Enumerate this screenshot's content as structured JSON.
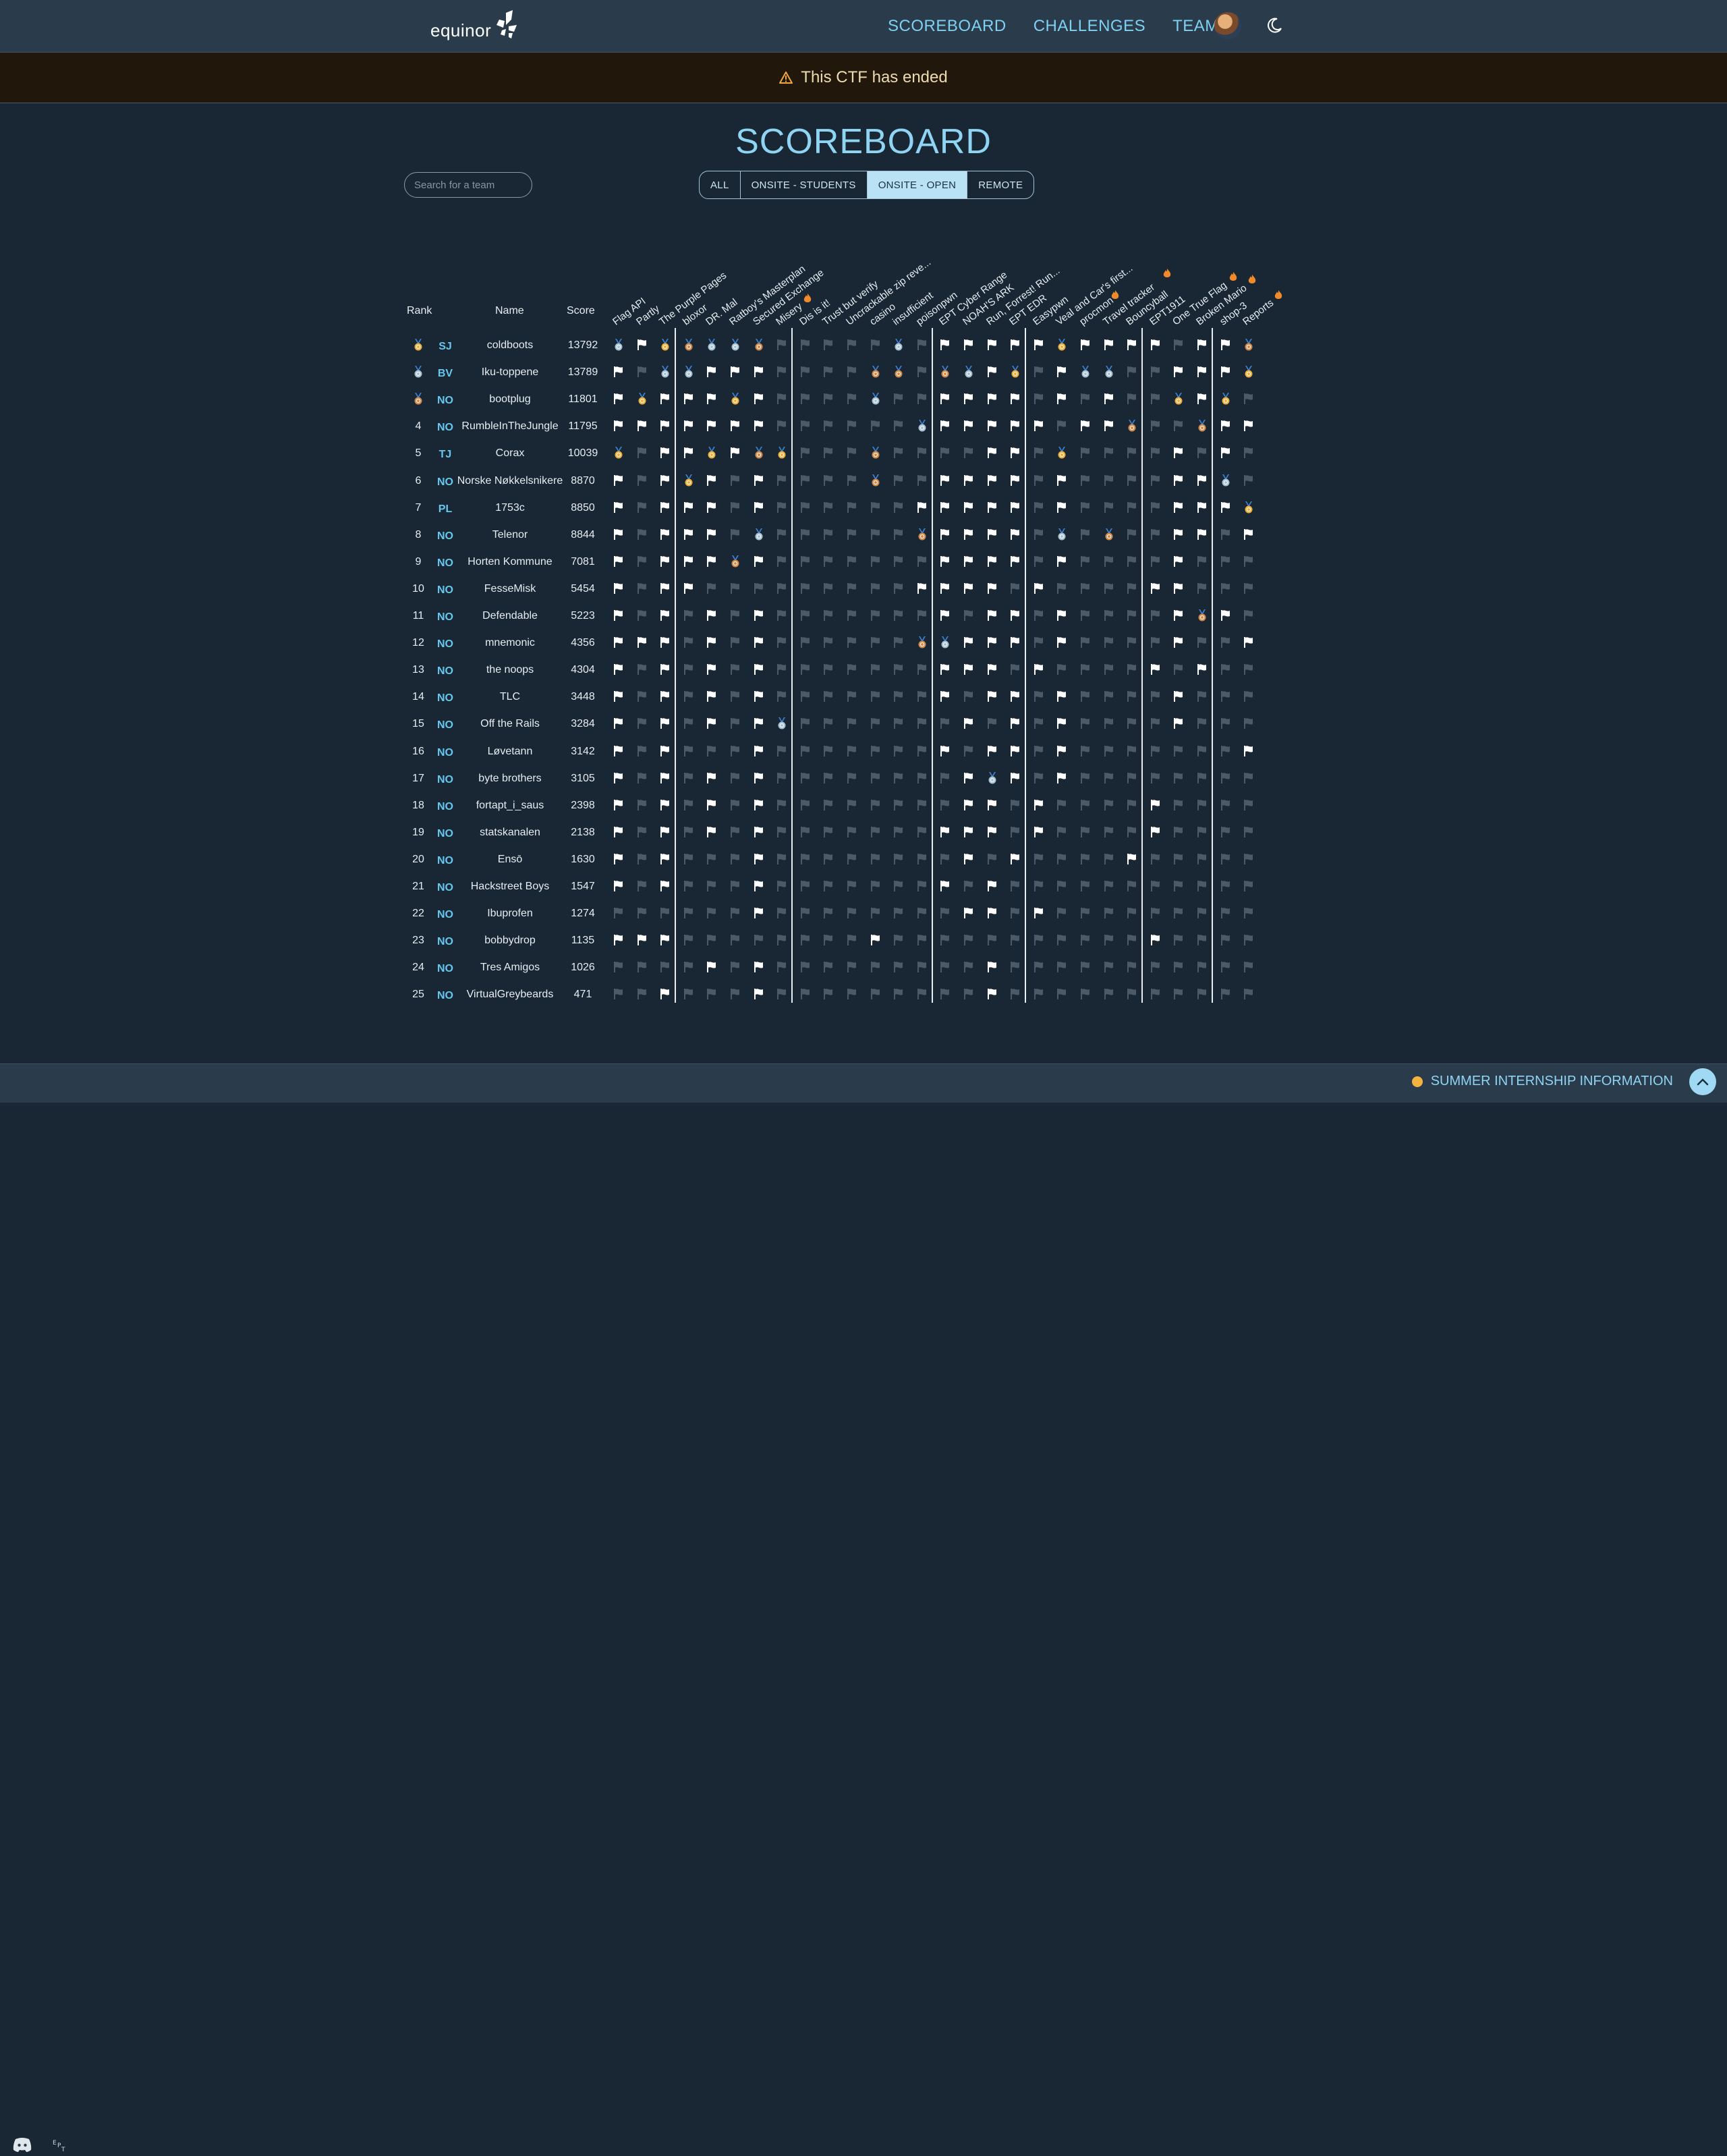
{
  "nav": {
    "logo_text": "equinor",
    "links": [
      "SCOREBOARD",
      "CHALLENGES",
      "TEAM"
    ]
  },
  "banner": {
    "text": "This CTF has ended"
  },
  "title": "SCOREBOARD",
  "search": {
    "placeholder": "Search for a team"
  },
  "filters": [
    {
      "label": "ALL",
      "active": false
    },
    {
      "label": "ONSITE - STUDENTS",
      "active": false
    },
    {
      "label": "ONSITE - OPEN",
      "active": true
    },
    {
      "label": "REMOTE",
      "active": false
    }
  ],
  "columns": {
    "rank": "Rank",
    "name": "Name",
    "score": "Score"
  },
  "challenges": [
    "Flag API",
    "Partly",
    "The Purple Pages",
    "bloxor",
    "DR. Mal",
    "Ratboy's Masterplan",
    "Secured Exchange",
    "Misery",
    "Dis is it!",
    "Trust but verify",
    "Uncrackable zip reve...",
    "casino",
    "insufficient",
    "poisonpwn",
    "EPT Cyber Range",
    "NOAH'S ARK",
    "Run, Forrest! Run...",
    "EPT EDR",
    "Easypwn",
    "Veal and Car's first...",
    "procmon",
    "Travel tracker",
    "Bouncyball",
    "EPT1911",
    "One True Flag",
    "Broken Mario",
    "shop-3",
    "Reports"
  ],
  "fire_challenges": [
    "Misery",
    "procmon",
    "Travel tracker",
    "One True Flag",
    "Broken Mario",
    "Reports"
  ],
  "legend": "S=solved, .=unsolved, G=gold medal, V=silver medal, B=bronze medal",
  "teams": [
    {
      "rank": "1",
      "medal": "G",
      "country": "SJ",
      "name": "coldboots",
      "score": "13792",
      "solves": "VSGBVVB.....V.SSSSSGSSSS.SSBSB"
    },
    {
      "rank": "2",
      "medal": "V",
      "country": "BV",
      "name": "Iku-toppene",
      "score": "13789",
      "solves": "S.VVSSS....BB.BVSG.SVV..SSSGS"
    },
    {
      "rank": "3",
      "medal": "B",
      "country": "NO",
      "name": "bootplug",
      "score": "11801",
      "solves": "SGSSSGS....V..SSSS.S.S..GSG.S"
    },
    {
      "rank": "4",
      "medal": "",
      "country": "NO",
      "name": "RumbleInTheJungle",
      "score": "11795",
      "solves": "SSSSSSS......VSSSSS.SSB..BSSVS"
    },
    {
      "rank": "5",
      "medal": "",
      "country": "TJ",
      "name": "Corax",
      "score": "10039",
      "solves": "G.SSGSBG...B....SS.G....S.S.S"
    },
    {
      "rank": "6",
      "medal": "",
      "country": "NO",
      "name": "Norske Nøkkelsnikere",
      "score": "8870",
      "solves": "S.SGS.S....B..SSSS.S....SSV."
    },
    {
      "rank": "7",
      "medal": "",
      "country": "PL",
      "name": "1753c",
      "score": "8850",
      "solves": "S.SSS.S......SSSSS.S....SSSGV"
    },
    {
      "rank": "8",
      "medal": "",
      "country": "NO",
      "name": "Telenor",
      "score": "8844",
      "solves": "S.SSS.V......BSSSS.V.B..SS.S."
    },
    {
      "rank": "9",
      "medal": "",
      "country": "NO",
      "name": "Horten Kommune",
      "score": "7081",
      "solves": "S.SSSBS.......SSSS.S....S...."
    },
    {
      "rank": "10",
      "medal": "",
      "country": "NO",
      "name": "FesseMisk",
      "score": "5454",
      "solves": "S.SS.........SSSS.S....SS..."
    },
    {
      "rank": "11",
      "medal": "",
      "country": "NO",
      "name": "Defendable",
      "score": "5223",
      "solves": "S.S.S.S.......S.SS.S....SBS.."
    },
    {
      "rank": "12",
      "medal": "",
      "country": "NO",
      "name": "mnemonic",
      "score": "4356",
      "solves": "SSS.S.S......BVSSS.S....S..S."
    },
    {
      "rank": "13",
      "medal": "",
      "country": "NO",
      "name": "the noops",
      "score": "4304",
      "solves": "S.S.S.S.......SSS.S....S.S.."
    },
    {
      "rank": "14",
      "medal": "",
      "country": "NO",
      "name": "TLC",
      "score": "3448",
      "solves": "S.S.S.S.......S.SS.S....S...."
    },
    {
      "rank": "15",
      "medal": "",
      "country": "NO",
      "name": "Off the Rails",
      "score": "3284",
      "solves": "S.S.S.SV.......S.S.S....S...."
    },
    {
      "rank": "16",
      "medal": "",
      "country": "NO",
      "name": "Løvetann",
      "score": "3142",
      "solves": "S.S...S.......S.SS.S.......S."
    },
    {
      "rank": "17",
      "medal": "",
      "country": "NO",
      "name": "byte brothers",
      "score": "3105",
      "solves": "S.S.S.S........SVS.S........"
    },
    {
      "rank": "18",
      "medal": "",
      "country": "NO",
      "name": "fortapt_i_saus",
      "score": "2398",
      "solves": "S.S.S.S........SS.S....S...."
    },
    {
      "rank": "19",
      "medal": "",
      "country": "NO",
      "name": "statskanalen",
      "score": "2138",
      "solves": "S.S.S.S.......SSS.S....S...."
    },
    {
      "rank": "20",
      "medal": "",
      "country": "NO",
      "name": "Ensō",
      "score": "1630",
      "solves": "S.S...S........S.S....S...."
    },
    {
      "rank": "21",
      "medal": "",
      "country": "NO",
      "name": "Hackstreet Boys",
      "score": "1547",
      "solves": "S.S...S.......S.S..........."
    },
    {
      "rank": "22",
      "medal": "",
      "country": "NO",
      "name": "Ibuprofen",
      "score": "1274",
      "solves": "......S........SS.S........."
    },
    {
      "rank": "23",
      "medal": "",
      "country": "NO",
      "name": "bobbydrop",
      "score": "1135",
      "solves": "SSS........S...........S...."
    },
    {
      "rank": "24",
      "medal": "",
      "country": "NO",
      "name": "Tres Amigos",
      "score": "1026",
      "solves": "....S.S.........S..........."
    },
    {
      "rank": "25",
      "medal": "",
      "country": "NO",
      "name": "VirtualGreybeards",
      "score": "471",
      "solves": "..S...S.........S..........."
    }
  ],
  "colors": {
    "gold": "#f0b03c",
    "silver": "#a9c3d6",
    "bronze": "#d68b4a",
    "accent": "#8fd4f3",
    "solved": "#ffffff",
    "unsolved": "#4b5a66"
  },
  "footer": {
    "info": "SUMMER INTERNSHIP INFORMATION"
  },
  "icons": {
    "discord": "discord-icon",
    "ept": "ept-logo-icon",
    "warning": "warning-icon",
    "moon": "moon-icon",
    "fire": "fire-icon",
    "up": "chevron-up-icon"
  }
}
